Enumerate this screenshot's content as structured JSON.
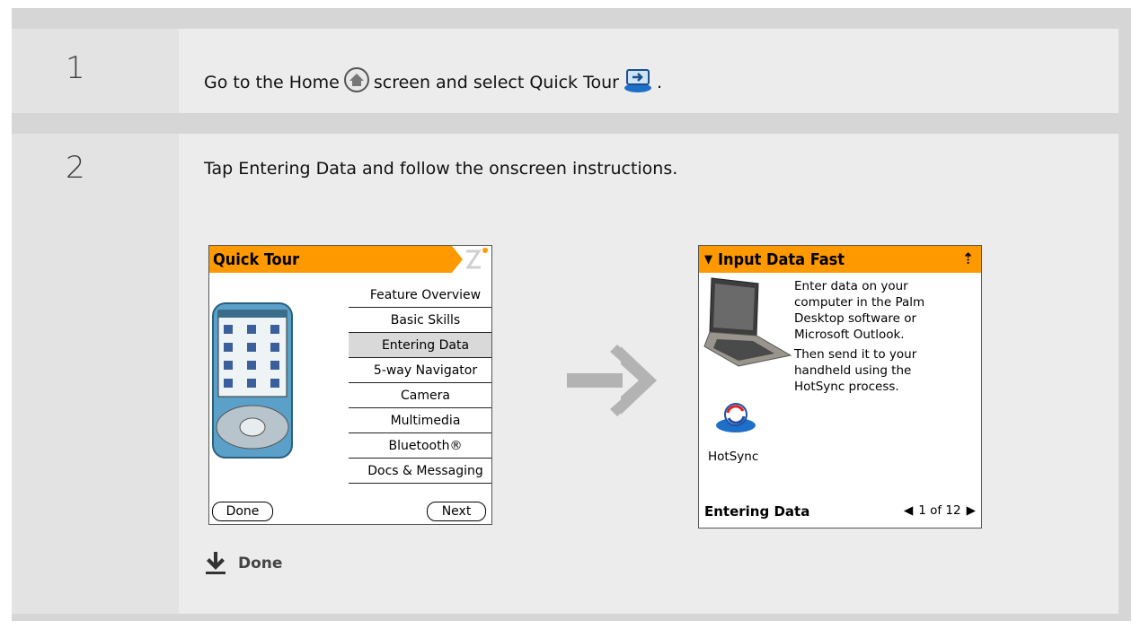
{
  "steps": [
    {
      "number": "1",
      "text_before": "Go to the Home",
      "text_middle": "screen and select Quick Tour",
      "text_after": ".",
      "icons": [
        "home-icon",
        "quick-tour-icon"
      ]
    },
    {
      "number": "2",
      "text": "Tap Entering Data and follow the onscreen instructions."
    }
  ],
  "quick_tour_screen": {
    "title": "Quick Tour",
    "menu": [
      "Feature Overview",
      "Basic Skills",
      "Entering Data",
      "5-way Navigator",
      "Camera",
      "Multimedia",
      "Bluetooth®",
      "Docs & Messaging"
    ],
    "selected": "Entering Data",
    "done_label": "Done",
    "next_label": "Next"
  },
  "input_screen": {
    "title": "Input Data Fast",
    "paragraph1": [
      "Enter data on your",
      "computer in the Palm",
      "Desktop software or",
      "Microsoft Outlook."
    ],
    "paragraph2": [
      "Then send it to your",
      "handheld using the",
      "HotSync process."
    ],
    "hotsync_label": "HotSync",
    "footer_title": "Entering Data",
    "page_indicator": "1 of 12"
  },
  "done_label": "Done",
  "colors": {
    "accent": "#ff9900",
    "arrow": "#b3b3b3"
  }
}
